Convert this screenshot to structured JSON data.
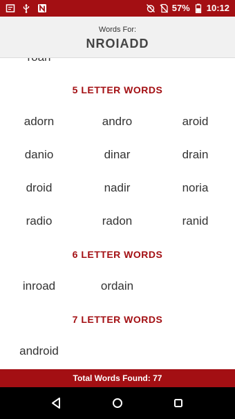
{
  "status_bar": {
    "battery_percent": "57%",
    "time": "10:12",
    "left_icons": [
      "app-icon",
      "usb-icon",
      "n-icon"
    ],
    "right_icons": [
      "alarm-off-icon",
      "no-sim-icon",
      "battery-icon"
    ]
  },
  "header": {
    "subtitle": "Words For:",
    "title": "NROIADD"
  },
  "content": {
    "partial_word": "roan",
    "sections": [
      {
        "title": "5 LETTER WORDS",
        "rows": [
          [
            "adorn",
            "andro",
            "aroid"
          ],
          [
            "danio",
            "dinar",
            "drain"
          ],
          [
            "droid",
            "nadir",
            "noria"
          ],
          [
            "radio",
            "radon",
            "ranid"
          ]
        ]
      },
      {
        "title": "6 LETTER WORDS",
        "rows": [
          [
            "inroad",
            "ordain"
          ]
        ]
      },
      {
        "title": "7 LETTER WORDS",
        "rows": [
          [
            "android"
          ]
        ]
      }
    ]
  },
  "footer": {
    "total_label": "Total Words Found: 77"
  },
  "nav": {
    "buttons": [
      "back",
      "home",
      "recents"
    ]
  },
  "colors": {
    "accent": "#a30f13",
    "header_bg": "#f1f1f1",
    "word_text": "#333333"
  }
}
